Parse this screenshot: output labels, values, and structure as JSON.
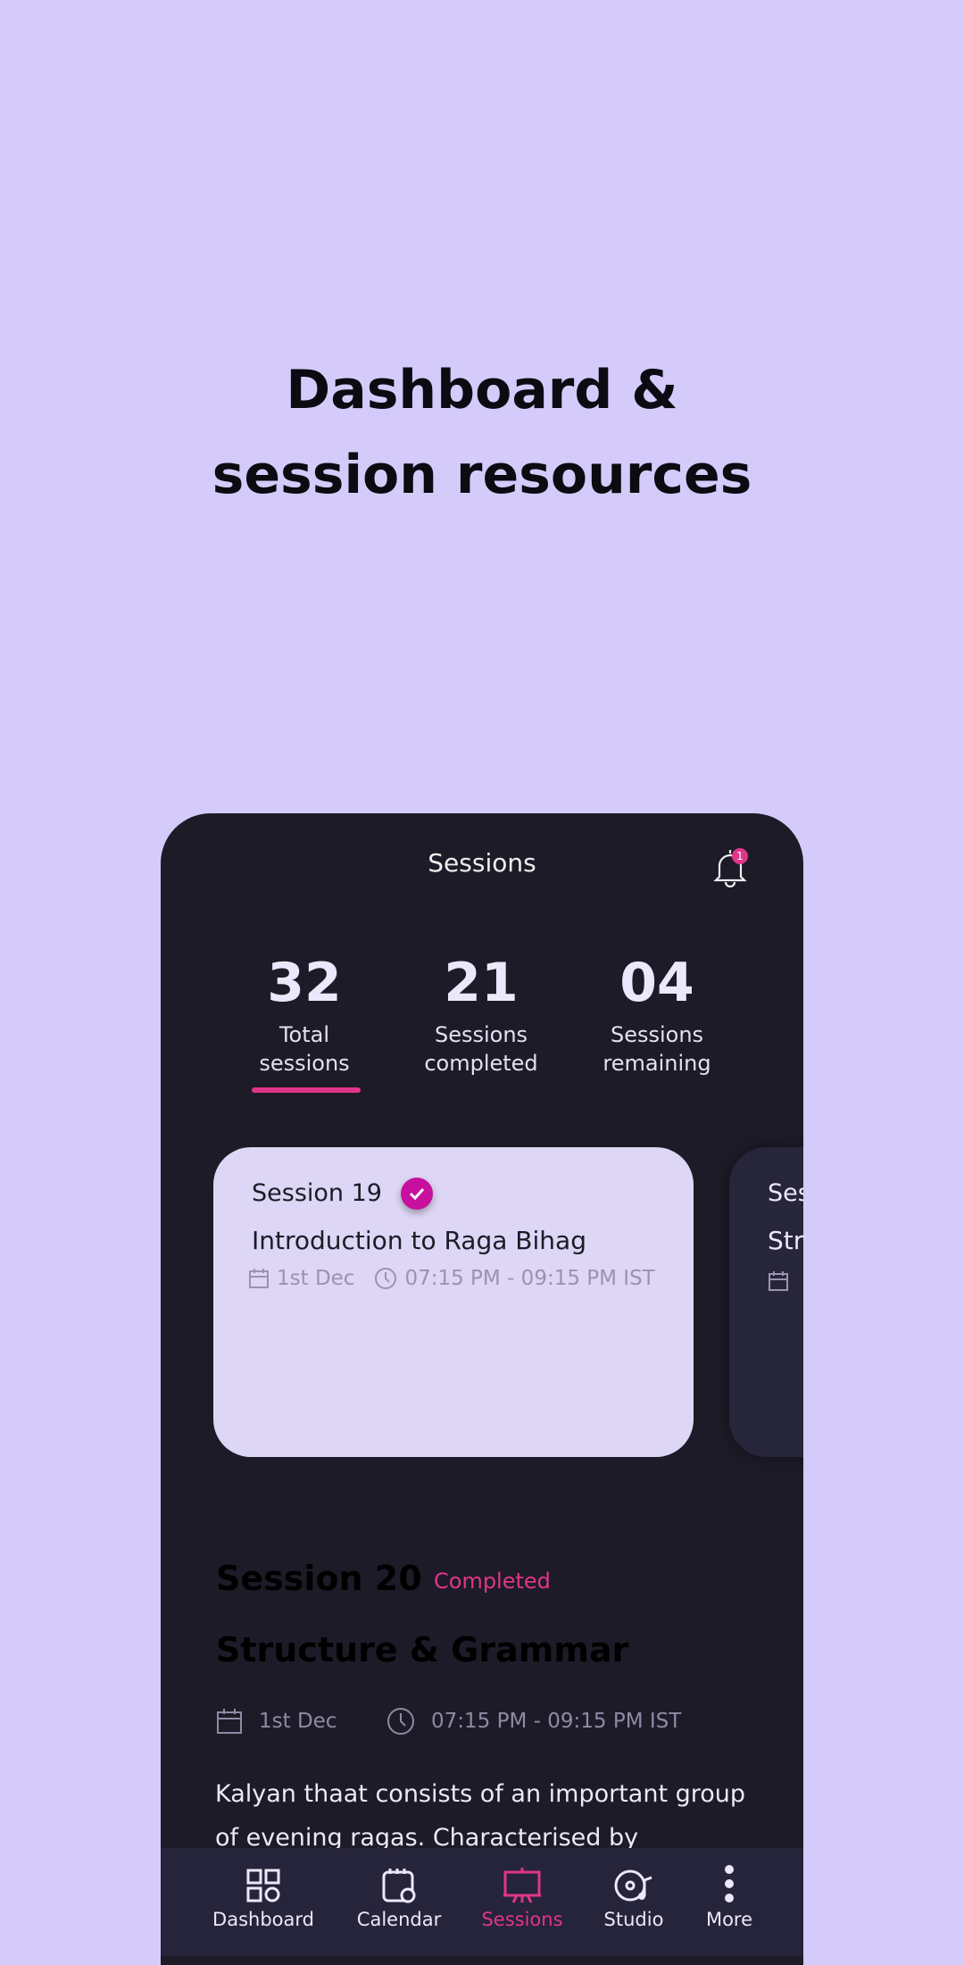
{
  "hero": {
    "line1": "Dashboard &",
    "line2": "session resources"
  },
  "header": {
    "title": "Sessions",
    "notification_count": "1"
  },
  "stats": [
    {
      "value": "32",
      "label1": "Total",
      "label2": "sessions"
    },
    {
      "value": "21",
      "label1": "Sessions",
      "label2": "completed"
    },
    {
      "value": "04",
      "label1": "Sessions",
      "label2": "remaining"
    }
  ],
  "cards": [
    {
      "session": "Session 19",
      "title": "Introduction to Raga Bihag",
      "date": "1st Dec",
      "time": "07:15 PM - 09:15 PM IST",
      "completed": true
    },
    {
      "session": "Ses",
      "title": "Str"
    }
  ],
  "detail": {
    "session": "Session 20",
    "status": "Completed",
    "title": "Structure & Grammar",
    "date": "1st Dec",
    "time": "07:15 PM - 09:15 PM IST",
    "description": "Kalyan thaat consists of an important group of evening ragas. Characterised by"
  },
  "nav": [
    {
      "label": "Dashboard",
      "icon": "grid-icon"
    },
    {
      "label": "Calendar",
      "icon": "calendar-clock-icon"
    },
    {
      "label": "Sessions",
      "icon": "easel-icon",
      "active": true
    },
    {
      "label": "Studio",
      "icon": "disc-music-icon"
    },
    {
      "label": "More",
      "icon": "more-vertical-icon"
    }
  ],
  "colors": {
    "background": "#d5cbfa",
    "phone": "#1d1b27",
    "accent": "#e0358a",
    "card": "#ddd6f4"
  }
}
